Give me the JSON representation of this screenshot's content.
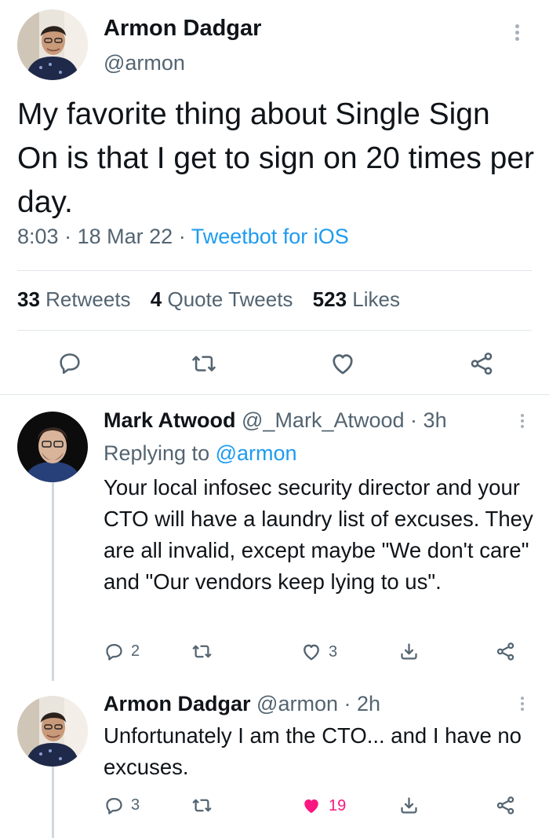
{
  "main_tweet": {
    "author_name": "Armon Dadgar",
    "author_handle": "@armon",
    "text": "My favorite thing about Single Sign On is that I get to sign on 20 times per day.",
    "time": "8:03",
    "date": "18 Mar 22",
    "source": "Tweetbot for iOS",
    "stats": {
      "retweets_count": "33",
      "retweets_label": "Retweets",
      "quotes_count": "4",
      "quotes_label": "Quote Tweets",
      "likes_count": "523",
      "likes_label": "Likes"
    },
    "actions": [
      "reply-icon",
      "retweet-icon",
      "like-icon",
      "share-icon"
    ]
  },
  "replies": [
    {
      "author_name": "Mark Atwood",
      "author_handle": "@_Mark_Atwood",
      "age": "3h",
      "replying_label": "Replying to",
      "replying_to": "@armon",
      "text": "Your local infosec security director and your CTO will have a laundry list of excuses. They are all invalid, except maybe \"We don't care\" and \"Our vendors keep lying to us\".",
      "reply_count": "2",
      "retweet_count": "",
      "like_count": "3",
      "liked": false
    },
    {
      "author_name": "Armon Dadgar",
      "author_handle": "@armon",
      "age": "2h",
      "text": "Unfortunately I am the CTO... and I have no excuses.",
      "reply_count": "3",
      "retweet_count": "",
      "like_count": "19",
      "liked": true
    }
  ],
  "colors": {
    "text": "#0f1419",
    "secondary": "#536471",
    "link": "#1d9bf0",
    "like": "#f91880",
    "divider": "#e1e6ea"
  },
  "sep": "·"
}
